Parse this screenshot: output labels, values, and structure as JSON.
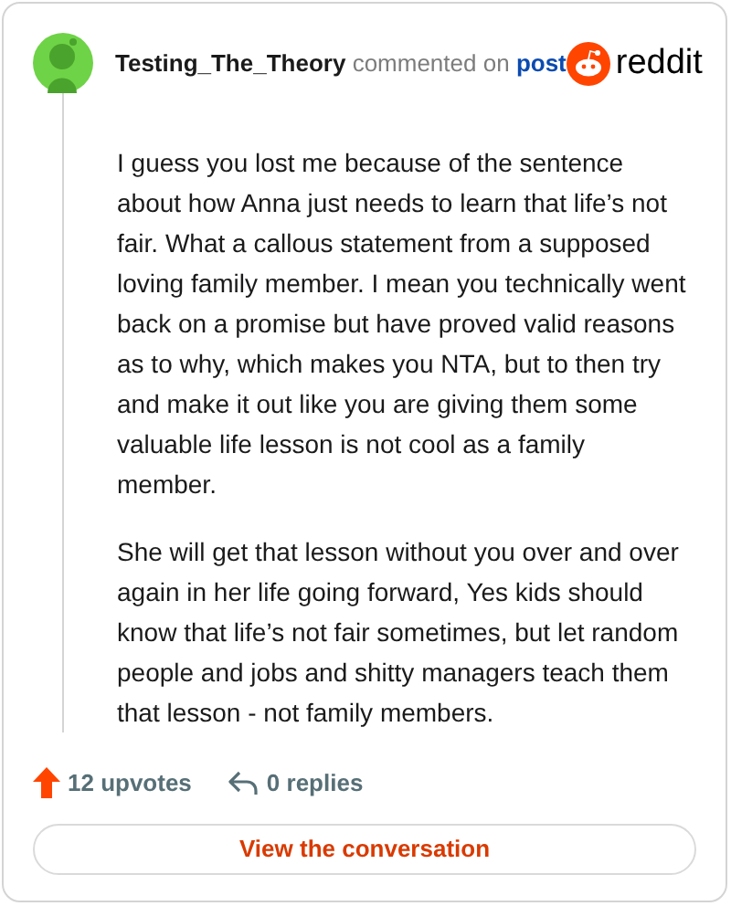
{
  "comment": {
    "author": "Testing_The_Theory",
    "action": "commented on",
    "link": "post"
  },
  "brand": {
    "name": "reddit"
  },
  "body": [
    "I guess you lost me because of the sentence about how Anna just needs to learn that life’s not fair. What a callous statement from a supposed loving family member. I mean you technically went back on a promise but have proved valid reasons as to why, which makes you NTA, but to then try and make it out like you are giving them some valuable life lesson is not cool as a family member.",
    "She will get that lesson without you over and over again in her life going forward, Yes kids should know that life’s not fair sometimes, but let random people and jobs and shitty managers teach them that lesson - not family members."
  ],
  "stats": {
    "upvotes": "12 upvotes",
    "replies": "0 replies"
  },
  "button": "View the conversation"
}
